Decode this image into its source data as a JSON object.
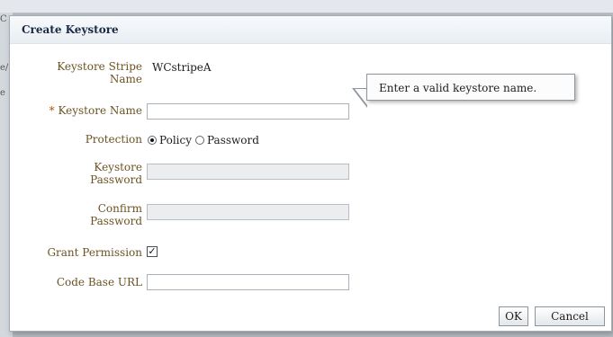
{
  "dialog": {
    "title": "Create Keystore"
  },
  "form": {
    "stripe_label": "Keystore Stripe Name",
    "stripe_label_line1": "Keystore Stripe",
    "stripe_label_line2": "Name",
    "stripe_value": "WCstripeA",
    "keystore_name_required_marker": "*",
    "keystore_name_label": "Keystore Name",
    "keystore_name_value": "",
    "protection_label": "Protection",
    "protection_options": [
      "Policy",
      "Password"
    ],
    "protection_selected": "Policy",
    "keystore_password_label_line1": "Keystore",
    "keystore_password_label_line2": "Password",
    "confirm_password_label_line1": "Confirm",
    "confirm_password_label_line2": "Password",
    "grant_permission_label": "Grant Permission",
    "grant_permission_checked": true,
    "code_base_url_label": "Code Base URL",
    "code_base_url_value": ""
  },
  "tooltip": {
    "text": "Enter a valid keystore name."
  },
  "buttons": {
    "ok": "OK",
    "cancel": "Cancel"
  },
  "background": {
    "fragment_1": "C",
    "fragment_2": "e/",
    "fragment_3": "e"
  },
  "colors": {
    "label": "#6b5322",
    "title": "#1a2a44",
    "required": "#b3560a",
    "disabled_field": "#ebedef"
  }
}
